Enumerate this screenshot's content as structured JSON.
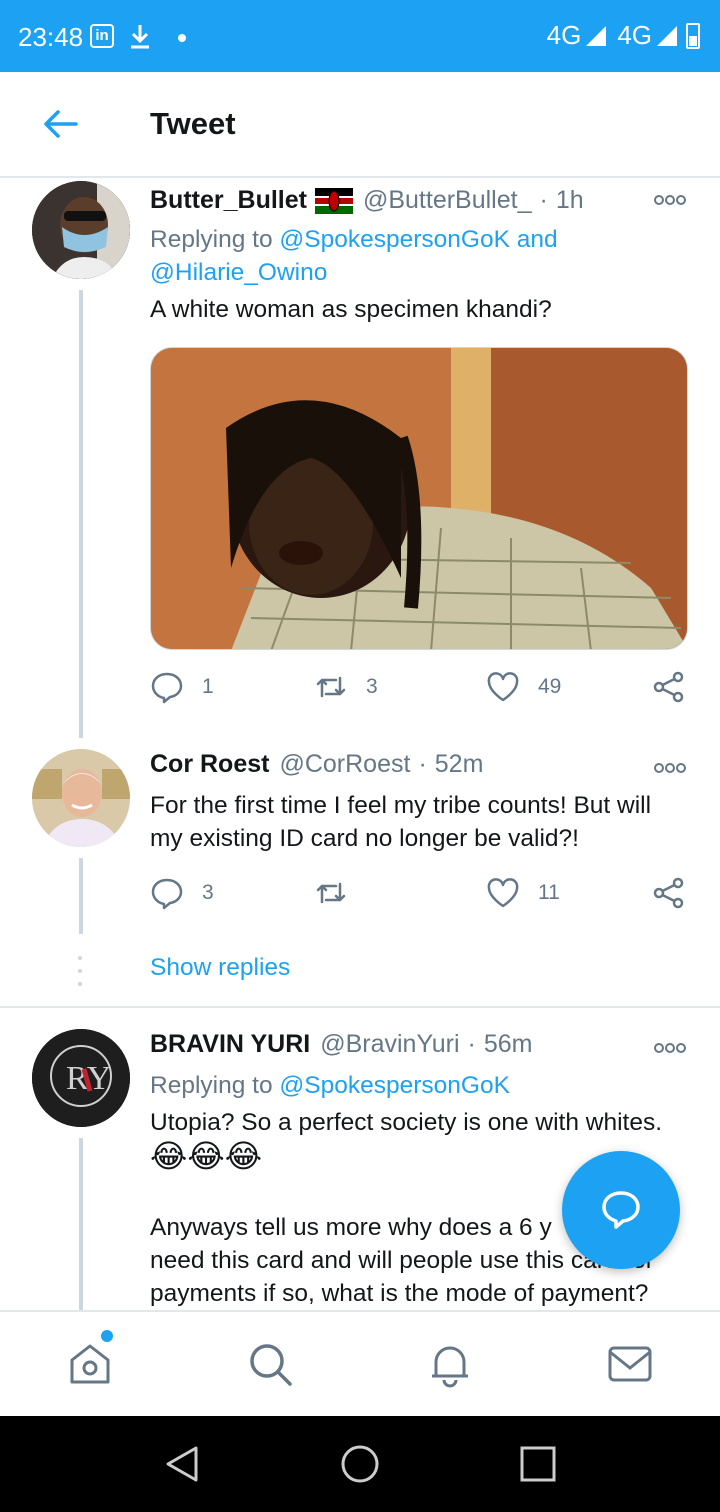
{
  "status_bar": {
    "time": "23:48",
    "app_icon": "in",
    "network": "4G",
    "network2": "4G"
  },
  "header": {
    "title": "Tweet"
  },
  "tweets": [
    {
      "name": "Butter_Bullet",
      "flag": "kenya-flag",
      "handle": "@ButterBullet_",
      "time": "1h",
      "reply_prefix": "Replying to",
      "mentions": [
        "@SpokespersonGoK",
        "and",
        "@Hilarie_Owino"
      ],
      "text": "A white woman as specimen khandi?",
      "replies": "1",
      "retweets": "3",
      "likes": "49"
    },
    {
      "name": "Cor Roest",
      "handle": "@CorRoest",
      "time": "52m",
      "text": "For the first time I feel my tribe counts! But will my existing ID card no longer be valid?!",
      "replies": "3",
      "retweets": "",
      "likes": "11"
    },
    {
      "name": "BRAVIN YURI",
      "handle": "@BravinYuri",
      "time": "56m",
      "reply_prefix": "Replying to",
      "mentions": [
        "@SpokespersonGoK"
      ],
      "text_line1": "Utopia? So a perfect society is one with whites.",
      "emoji": "😂😂😂",
      "text_para2_line1": "Anyways tell us more  why does a 6 y",
      "text_para2_line2": "need this card and will people use this card for",
      "text_para2_line3": "payments if so, what is the mode of payment?"
    }
  ],
  "show_replies": "Show replies",
  "bravin_avatar_initials": "RY",
  "colors": {
    "accent": "#1da1f2",
    "text": "#14171a",
    "muted": "#657786",
    "border": "#e1e8ed"
  }
}
